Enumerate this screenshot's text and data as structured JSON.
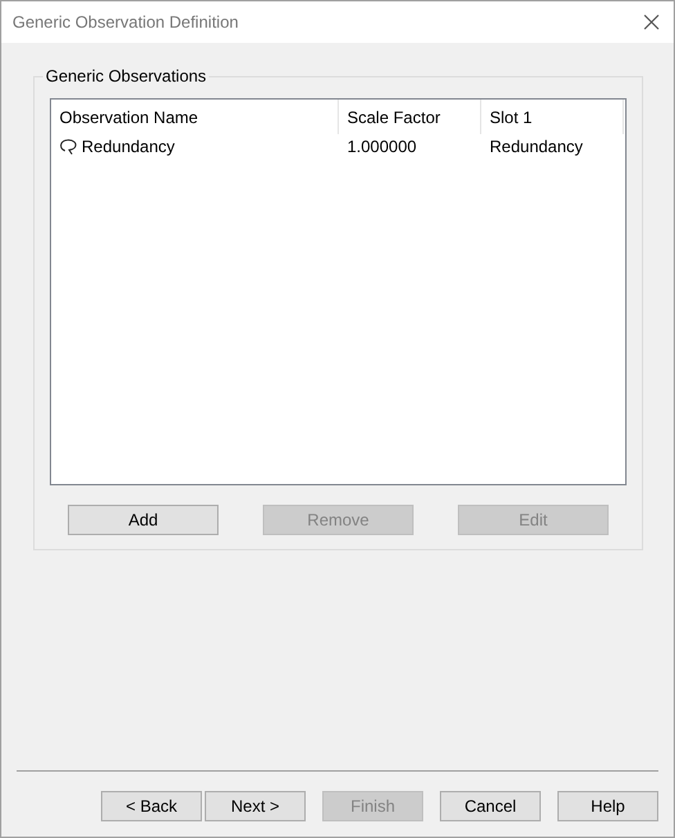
{
  "window": {
    "title": "Generic Observation Definition"
  },
  "group": {
    "title": "Generic Observations",
    "list": {
      "columns": [
        "Observation Name",
        "Scale Factor",
        "Slot 1"
      ],
      "rows": [
        {
          "cells": [
            "Redundancy",
            "1.000000",
            "Redundancy"
          ]
        }
      ]
    },
    "buttons": [
      {
        "label": "Add",
        "disabled": false
      },
      {
        "label": "Remove",
        "disabled": true
      },
      {
        "label": "Edit",
        "disabled": true
      }
    ]
  },
  "wizard_buttons": [
    {
      "label": "< Back",
      "disabled": false
    },
    {
      "label": "Next >",
      "disabled": false
    },
    {
      "label": "Finish",
      "disabled": true
    },
    {
      "label": "Cancel",
      "disabled": false
    },
    {
      "label": "Help",
      "disabled": false
    }
  ]
}
